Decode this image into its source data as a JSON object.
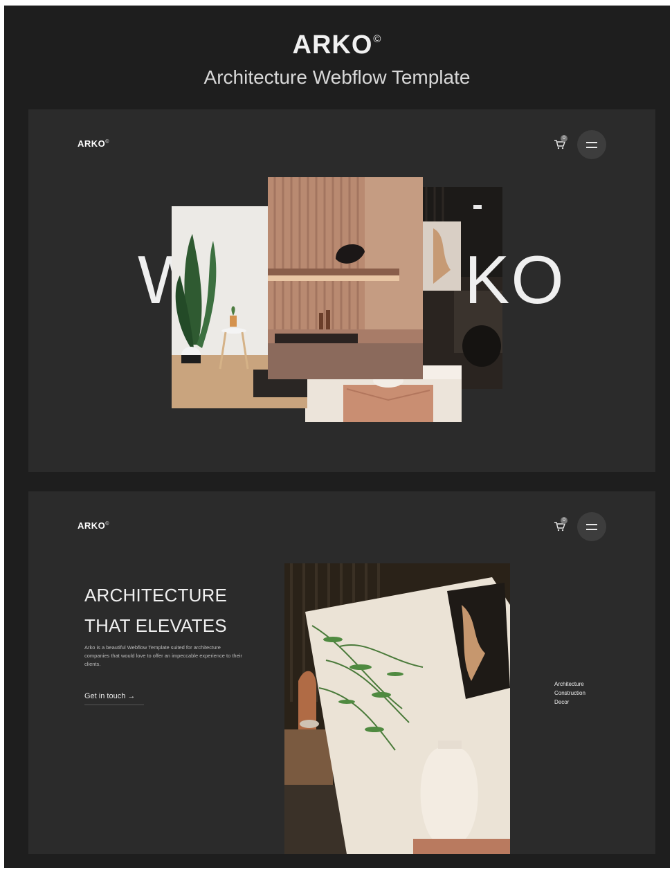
{
  "header": {
    "title": "ARKO",
    "title_mark": "©",
    "subtitle": "Architecture Webflow Template"
  },
  "nav": {
    "logo": "ARKO",
    "logo_mark": "©",
    "cart_count": "0",
    "cart_icon": "cart-icon",
    "menu_icon": "hamburger-menu-icon"
  },
  "hero": {
    "word_left": "W",
    "word_right": "KO"
  },
  "about": {
    "headline_line1": "ARCHITECTURE",
    "headline_line2": "THAT ELEVATES",
    "description": "Arko is a beautiful Webflow Template suited for architecture companies that would love to offer an impeccable experience to their clients.",
    "cta_label": "Get in touch",
    "cta_arrow": "→",
    "services": [
      "Architecture",
      "Construction",
      "Decor"
    ]
  },
  "colors": {
    "background": "#1e1e1e",
    "card": "#2b2b2b",
    "text": "#f0f0f0"
  }
}
